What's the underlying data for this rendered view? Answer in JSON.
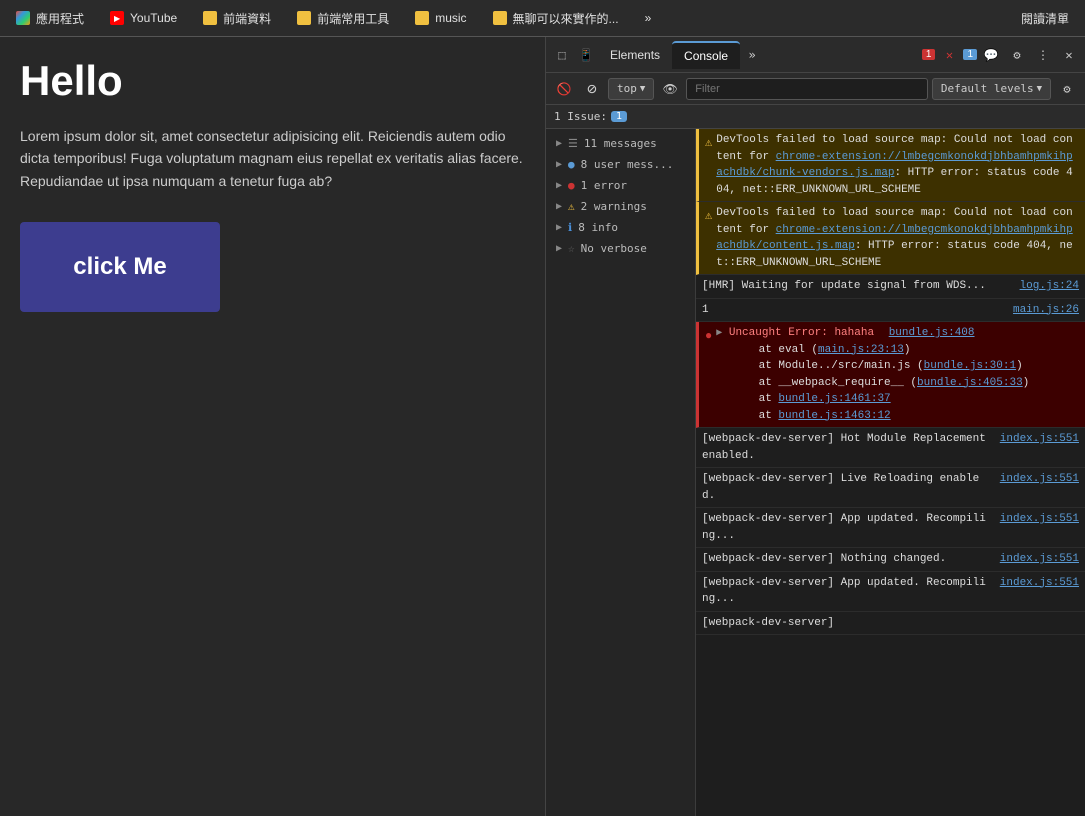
{
  "browser": {
    "tabs": [
      {
        "id": "apps",
        "label": "應用程式",
        "favicon_type": "apps",
        "active": false
      },
      {
        "id": "youtube",
        "label": "YouTube",
        "favicon_type": "yt",
        "active": false
      },
      {
        "id": "frontend-data",
        "label": "前端資料",
        "favicon_type": "folder",
        "active": false
      },
      {
        "id": "frontend-tools",
        "label": "前端常用工具",
        "favicon_type": "folder",
        "active": false
      },
      {
        "id": "music",
        "label": "music",
        "favicon_type": "folder",
        "active": false
      },
      {
        "id": "boredom",
        "label": "無聊可以來實作的...",
        "favicon_type": "folder",
        "active": false
      },
      {
        "id": "more",
        "label": "»",
        "active": false
      },
      {
        "id": "read-list",
        "label": "閱讀清單",
        "active": false
      }
    ],
    "omnibox_value": ""
  },
  "page": {
    "title": "Hello",
    "body_text": "Lorem ipsum dolor sit, amet consectetur adipisicing elit. Reiciendis autem odio dicta temporibus! Fuga voluptatum magnam eius repellat ex veritatis alias facere. Repudiandae ut ipsa numquam a tenetur fuga ab?",
    "button_label": "click Me"
  },
  "devtools": {
    "tabs": [
      {
        "id": "cursor",
        "label": "",
        "icon": "cursor"
      },
      {
        "id": "device",
        "label": "",
        "icon": "device"
      },
      {
        "id": "elements",
        "label": "Elements"
      },
      {
        "id": "console",
        "label": "Console",
        "active": true
      },
      {
        "id": "more-tabs",
        "label": "»"
      }
    ],
    "top_controls": {
      "error_badge": "1",
      "info_badge": "1",
      "gear_icon": "⚙",
      "more_icon": "⋮",
      "close_icon": "✕"
    },
    "second_bar": {
      "block_icon": "🚫",
      "clear_icon": "⊘",
      "top_label": "top",
      "eye_icon": "👁",
      "filter_placeholder": "Filter",
      "default_levels": "Default levels",
      "settings_icon": "⚙"
    },
    "issues_bar": {
      "label": "1 Issue:",
      "badge": "1"
    },
    "msg_filters": [
      {
        "id": "all",
        "label": "11 messages",
        "count": "",
        "icon": "▶",
        "icon2": "☰"
      },
      {
        "id": "user",
        "label": "8 user mess...",
        "count": "",
        "icon": "▶",
        "icon2": "🔵"
      },
      {
        "id": "error",
        "label": "1 error",
        "count": "",
        "icon": "▶",
        "icon2": "🔴"
      },
      {
        "id": "warnings",
        "label": "2 warnings",
        "count": "",
        "icon": "▶",
        "icon2": "⚠"
      },
      {
        "id": "info",
        "label": "8 info",
        "count": "",
        "icon": "▶",
        "icon2": "ℹ"
      },
      {
        "id": "verbose",
        "label": "No verbose",
        "count": "",
        "icon": "▶",
        "icon2": "☆"
      }
    ],
    "console_messages": [
      {
        "type": "warn",
        "content": "DevTools failed to load source map: Could not load content for chrome-extension://lmbegcmkonokdjbhbamhpmkihpachdbk/chunk-vendors.js.map: HTTP error: status code 404, net::ERR_UNKNOWN_URL_SCHEME",
        "source": "",
        "expandable": false
      },
      {
        "type": "warn",
        "content": "DevTools failed to load source map: Could not load content for chrome-extension://lmbegcmkonokdjbhbamhpmkihpachdbk/content.js.map: HTTP error: status code 404, net::ERR_UNKNOWN_URL_SCHEME",
        "source": "",
        "expandable": false
      },
      {
        "type": "info",
        "content": "[HMR] Waiting for update signal from WDS...",
        "source": "log.js:24",
        "expandable": false
      },
      {
        "type": "info",
        "content": "1",
        "source": "main.js:26",
        "expandable": false
      },
      {
        "type": "error",
        "content": "▶ Uncaught Error: hahaha\n    at eval (main.js:23:13)\n    at Module../src/main.js (bundle.js:30:1)\n    at __webpack_require__ (bundle.js:405:33)\n    at bundle.js:1461:37\n    at bundle.js:1463:12",
        "source": "bundle.js:408",
        "source2": "bundle.js:30:1",
        "source3": "bundle.js:405:33",
        "source4": "bundle.js:1461:37",
        "source5": "bundle.js:1463:12",
        "expandable": true
      },
      {
        "type": "info",
        "content": "[webpack-dev-server] Hot Module Replacement enabled.",
        "source": "index.js:551",
        "expandable": false
      },
      {
        "type": "info",
        "content": "[webpack-dev-server] Live Reloading enabled.",
        "source": "index.js:551",
        "expandable": false
      },
      {
        "type": "info",
        "content": "[webpack-dev-server] App updated. Recompiling...",
        "source": "index.js:551",
        "expandable": false
      },
      {
        "type": "info",
        "content": "[webpack-dev-server] Nothing changed.",
        "source": "index.js:551",
        "expandable": false
      },
      {
        "type": "info",
        "content": "[webpack-dev-server] App updated. Recompiling...",
        "source": "index.js:551",
        "expandable": false
      },
      {
        "type": "info",
        "content": "[webpack-dev-server]",
        "source": "",
        "expandable": false
      }
    ]
  }
}
